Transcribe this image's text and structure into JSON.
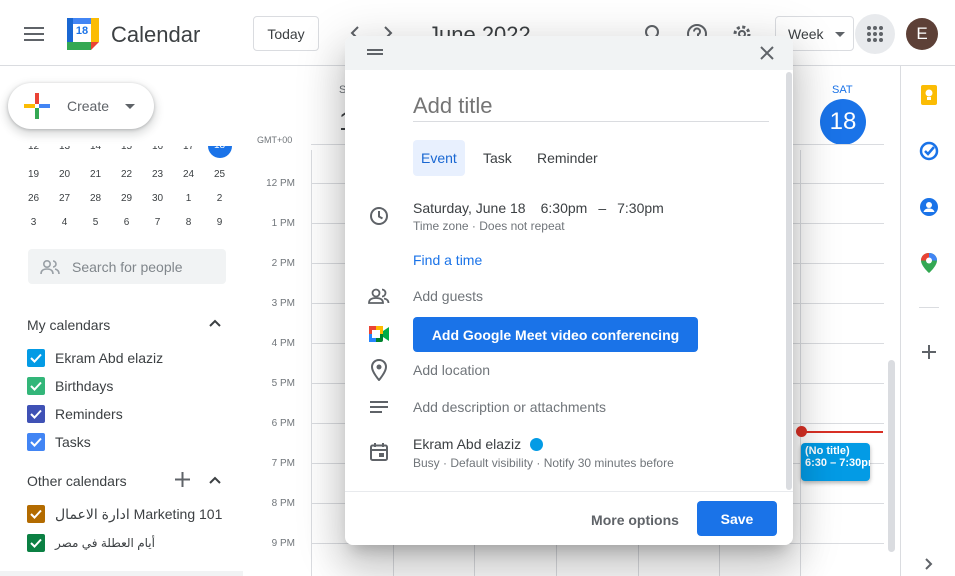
{
  "header": {
    "app_title": "Calendar",
    "logo_day": "18",
    "today_label": "Today",
    "month_label": "June 2022",
    "view_label": "Week",
    "avatar_letter": "E"
  },
  "sidebar": {
    "create_label": "Create",
    "mini_calendar_rows": [
      [
        "12",
        "13",
        "14",
        "15",
        "16",
        "17",
        "18"
      ],
      [
        "19",
        "20",
        "21",
        "22",
        "23",
        "24",
        "25"
      ],
      [
        "26",
        "27",
        "28",
        "29",
        "30",
        "1",
        "2"
      ],
      [
        "3",
        "4",
        "5",
        "6",
        "7",
        "8",
        "9"
      ]
    ],
    "search_placeholder": "Search for people",
    "my_calendars_title": "My calendars",
    "my_calendars": [
      {
        "name": "Ekram Abd elaziz",
        "color": "#039be5"
      },
      {
        "name": "Birthdays",
        "color": "#33b679"
      },
      {
        "name": "Reminders",
        "color": "#3f51b5"
      },
      {
        "name": "Tasks",
        "color": "#4285f4"
      }
    ],
    "other_calendars_title": "Other calendars",
    "other_calendars": [
      {
        "name": "ادارة الاعمال Marketing 101",
        "color": "#b36b00"
      },
      {
        "name": "أيام العطلة في مصر",
        "color": "#0b8043"
      }
    ]
  },
  "grid": {
    "timezone": "GMT+00",
    "day_abbr_partial": "S",
    "day_num_partial": "1",
    "sat_label": "SAT",
    "sat_number": "18",
    "hours": [
      "12 PM",
      "1 PM",
      "2 PM",
      "3 PM",
      "4 PM",
      "5 PM",
      "6 PM",
      "7 PM",
      "8 PM",
      "9 PM"
    ],
    "event_title": "(No title)",
    "event_time": "6:30 – 7:30pm"
  },
  "dialog": {
    "title_placeholder": "Add title",
    "tabs": [
      "Event",
      "Task",
      "Reminder"
    ],
    "date": "Saturday, June 18",
    "start_time": "6:30pm",
    "dash": "–",
    "end_time": "7:30pm",
    "timezone_line": "Time zone · Does not repeat",
    "find_time": "Find a time",
    "add_guests": "Add guests",
    "meet_button": "Add Google Meet video conferencing",
    "add_location": "Add location",
    "add_description": "Add description or attachments",
    "calendar_owner": "Ekram Abd elaziz",
    "calendar_color": "#039be5",
    "calendar_details": "Busy · Default visibility · Notify 30 minutes before",
    "more_options": "More options",
    "save": "Save"
  },
  "colors": {
    "accent": "#1a73e8",
    "event": "#039be5",
    "now_line": "#d93025"
  }
}
